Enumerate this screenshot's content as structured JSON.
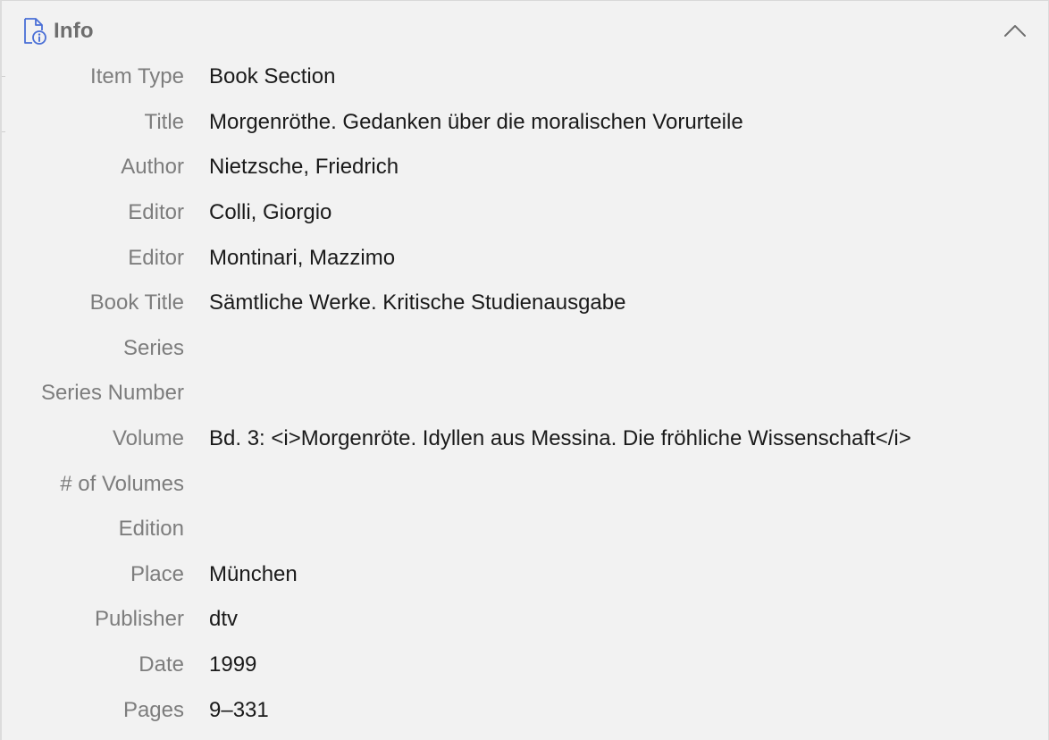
{
  "section": {
    "title": "Info",
    "icon": "document-info-icon",
    "collapse_icon": "chevron-up-icon",
    "accent_color": "#4a6fd6"
  },
  "fields": [
    {
      "label": "Item Type",
      "value": "Book Section"
    },
    {
      "label": "Title",
      "value": "Morgenröthe. Gedanken über die moralischen Vorurteile"
    },
    {
      "label": "Author",
      "value": "Nietzsche, Friedrich"
    },
    {
      "label": "Editor",
      "value": "Colli, Giorgio"
    },
    {
      "label": "Editor",
      "value": "Montinari, Mazzimo"
    },
    {
      "label": "Book Title",
      "value": "Sämtliche Werke. Kritische Studienausgabe"
    },
    {
      "label": "Series",
      "value": ""
    },
    {
      "label": "Series Number",
      "value": ""
    },
    {
      "label": "Volume",
      "value": "Bd. 3: <i>Morgenröte. Idyllen aus Messina. Die fröhliche Wissenschaft</i>"
    },
    {
      "label": "# of Volumes",
      "value": ""
    },
    {
      "label": "Edition",
      "value": ""
    },
    {
      "label": "Place",
      "value": "München"
    },
    {
      "label": "Publisher",
      "value": "dtv"
    },
    {
      "label": "Date",
      "value": "1999"
    },
    {
      "label": "Pages",
      "value": "9–331"
    }
  ]
}
